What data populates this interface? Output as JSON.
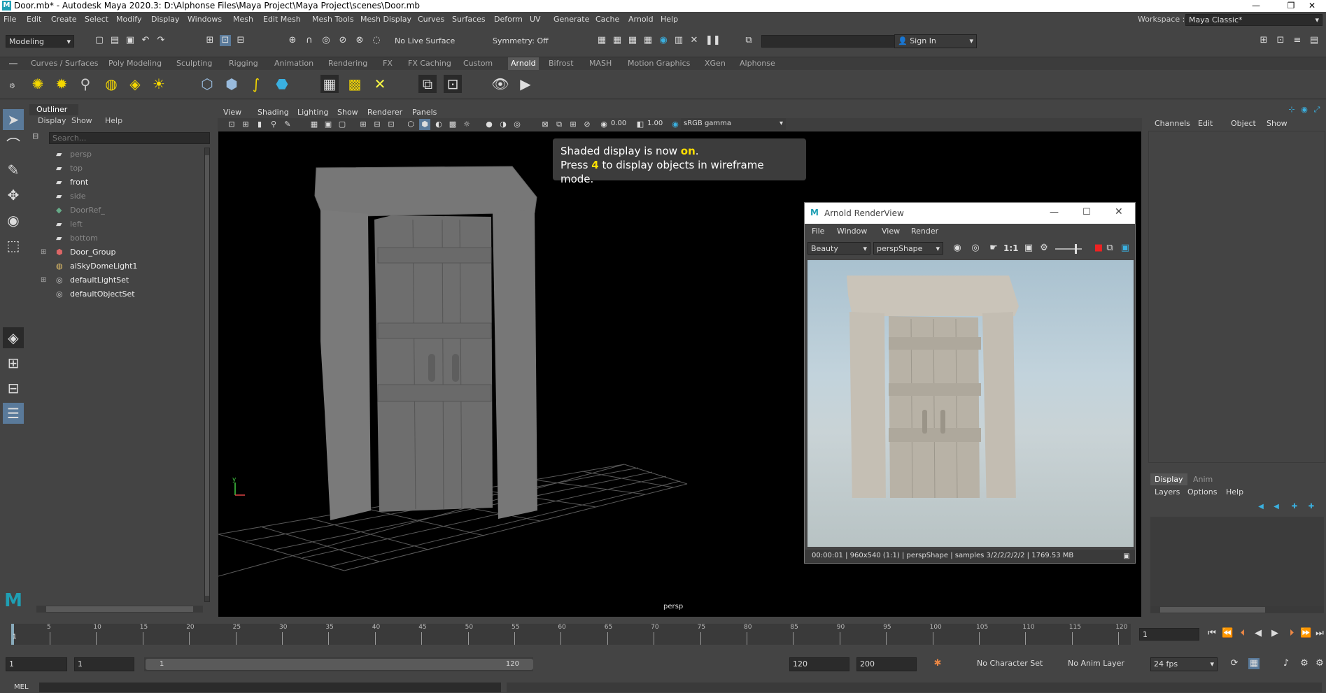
{
  "app": {
    "title": "Door.mb* - Autodesk Maya 2020.3: D:\\Alphonse Files\\Maya Project\\Maya Project\\scenes\\Door.mb",
    "workspace_label": "Workspace :",
    "workspace_value": "Maya Classic*"
  },
  "menubar": [
    "File",
    "Edit",
    "Create",
    "Select",
    "Modify",
    "Display",
    "Windows",
    "Mesh",
    "Edit Mesh",
    "Mesh Tools",
    "Mesh Display",
    "Curves",
    "Surfaces",
    "Deform",
    "UV",
    "Generate",
    "Cache",
    "Arnold",
    "Help"
  ],
  "statusline": {
    "mode": "Modeling",
    "live_surface": "No Live Surface",
    "symmetry": "Symmetry: Off",
    "sign_in": "Sign In"
  },
  "shelf_tabs": [
    "Curves / Surfaces",
    "Poly Modeling",
    "Sculpting",
    "Rigging",
    "Animation",
    "Rendering",
    "FX",
    "FX Caching",
    "Custom",
    "Arnold",
    "Bifrost",
    "MASH",
    "Motion Graphics",
    "XGen",
    "Alphonse"
  ],
  "shelf_active": "Arnold",
  "outliner": {
    "title": "Outliner",
    "menus": [
      "Display",
      "Show",
      "Help"
    ],
    "search_placeholder": "Search...",
    "items": [
      {
        "label": "persp",
        "dim": true,
        "icon": "camera-icon"
      },
      {
        "label": "top",
        "dim": true,
        "icon": "camera-icon"
      },
      {
        "label": "front",
        "dim": false,
        "icon": "camera-icon"
      },
      {
        "label": "side",
        "dim": true,
        "icon": "camera-icon"
      },
      {
        "label": "DoorRef_",
        "dim": true,
        "icon": "reference-icon"
      },
      {
        "label": "left",
        "dim": true,
        "icon": "camera-icon"
      },
      {
        "label": "bottom",
        "dim": true,
        "icon": "camera-icon"
      },
      {
        "label": "Door_Group",
        "dim": false,
        "icon": "group-icon",
        "expand": "+"
      },
      {
        "label": "aiSkyDomeLight1",
        "dim": false,
        "icon": "light-icon"
      },
      {
        "label": "defaultLightSet",
        "dim": false,
        "icon": "set-icon",
        "expand": "+"
      },
      {
        "label": "defaultObjectSet",
        "dim": false,
        "icon": "set-icon"
      }
    ]
  },
  "viewport": {
    "menus": [
      "View",
      "Shading",
      "Lighting",
      "Show",
      "Renderer",
      "Panels"
    ],
    "exposure": "0.00",
    "gamma": "1.00",
    "color_space": "sRGB gamma",
    "camera_label": "persp",
    "hud_line1_a": "Shaded display is now ",
    "hud_line1_b": "on",
    "hud_line1_c": ".",
    "hud_line2_a": "Press ",
    "hud_line2_b": "4",
    "hud_line2_c": " to display objects in wireframe mode."
  },
  "renderview": {
    "title": "Arnold RenderView",
    "menus": [
      "File",
      "Window",
      "View",
      "Render"
    ],
    "aov": "Beauty",
    "camera": "perspShape",
    "ratio": "1:1",
    "status": "00:00:01 | 960x540 (1:1) | perspShape  | samples 3/2/2/2/2/2 | 1769.53 MB"
  },
  "channels": {
    "menus": [
      "Channels",
      "Edit",
      "Object",
      "Show"
    ],
    "layer_tabs": [
      "Display",
      "Anim"
    ],
    "layer_menus": [
      "Layers",
      "Options",
      "Help"
    ]
  },
  "timeline": {
    "ticks": [
      "5",
      "10",
      "15",
      "20",
      "25",
      "30",
      "35",
      "40",
      "45",
      "50",
      "55",
      "60",
      "65",
      "70",
      "75",
      "80",
      "85",
      "90",
      "95",
      "100",
      "105",
      "110",
      "115",
      "120"
    ],
    "current_frame": "1",
    "frame_field": "1"
  },
  "range": {
    "start": "1",
    "start2": "1",
    "slider_start": "1",
    "slider_end": "120",
    "end": "120",
    "end2": "200",
    "character_set": "No Character Set",
    "anim_layer": "No Anim Layer",
    "fps": "24 fps"
  },
  "cmdline": {
    "label": "MEL"
  }
}
